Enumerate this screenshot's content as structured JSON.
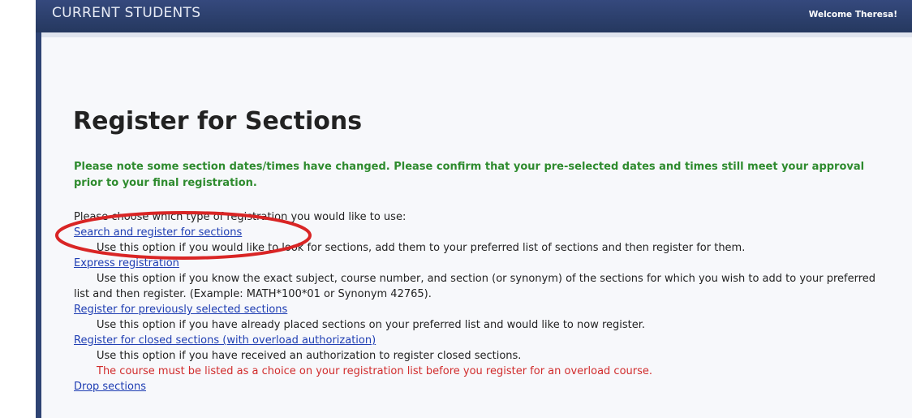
{
  "header": {
    "title": "CURRENT STUDENTS",
    "welcome": "Welcome Theresa!"
  },
  "page": {
    "title": "Register for Sections",
    "notice": "Please note some section dates/times have changed. Please confirm that your pre-selected dates and times still meet your approval prior to your final registration.",
    "prompt": "Please choose which type of registration you would like to use:"
  },
  "options": [
    {
      "label": "Search and register for sections",
      "description": "Use this option if you would like to look for sections, add them to your preferred list of sections and then register for them."
    },
    {
      "label": "Express registration",
      "description": "Use this option if you know the exact subject, course number, and section (or synonym) of the sections for which you wish to add to your preferred list and then register. (Example: MATH*100*01 or Synonym 42765)."
    },
    {
      "label": "Register for previously selected sections",
      "description": "Use this option if you have already placed sections on your preferred list and would like to now register."
    },
    {
      "label": "Register for closed sections (with overload authorization)",
      "description": "Use this option if you have received an authorization to register closed sections.",
      "warning": "The course must be listed as a choice on your registration list before you register for an overload course."
    },
    {
      "label": "Drop sections"
    }
  ],
  "colors": {
    "header": "#2e4373",
    "notice": "#2e8b2e",
    "link": "#1f3eb3",
    "warning": "#d12c2c",
    "annotation": "#d92525"
  }
}
